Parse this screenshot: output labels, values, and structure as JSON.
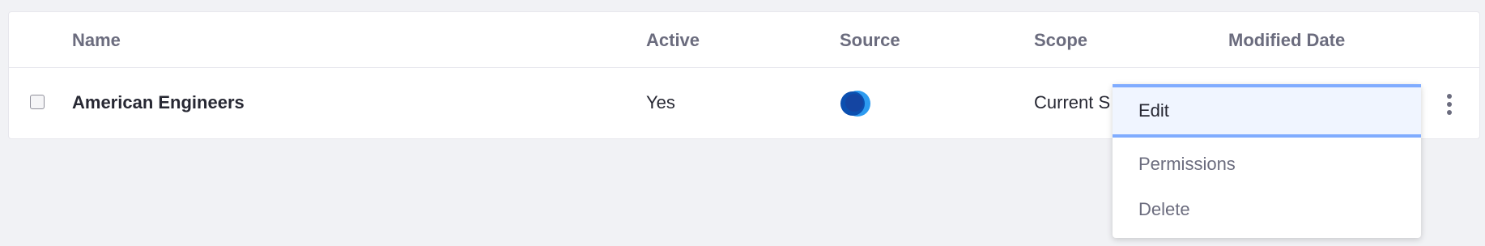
{
  "table": {
    "columns": [
      "Name",
      "Active",
      "Source",
      "Scope",
      "Modified Date"
    ],
    "rows": [
      {
        "name": "American Engineers",
        "active": "Yes",
        "source_icon": "source-logo-icon",
        "scope": "Current S",
        "modified_date": ""
      }
    ]
  },
  "dropdown": {
    "items": [
      "Edit",
      "Permissions",
      "Delete"
    ],
    "active_item": "Edit"
  },
  "colors": {
    "accent": "#80acff",
    "logo_dark": "#0b4fb0",
    "logo_light": "#2d9bf0"
  }
}
